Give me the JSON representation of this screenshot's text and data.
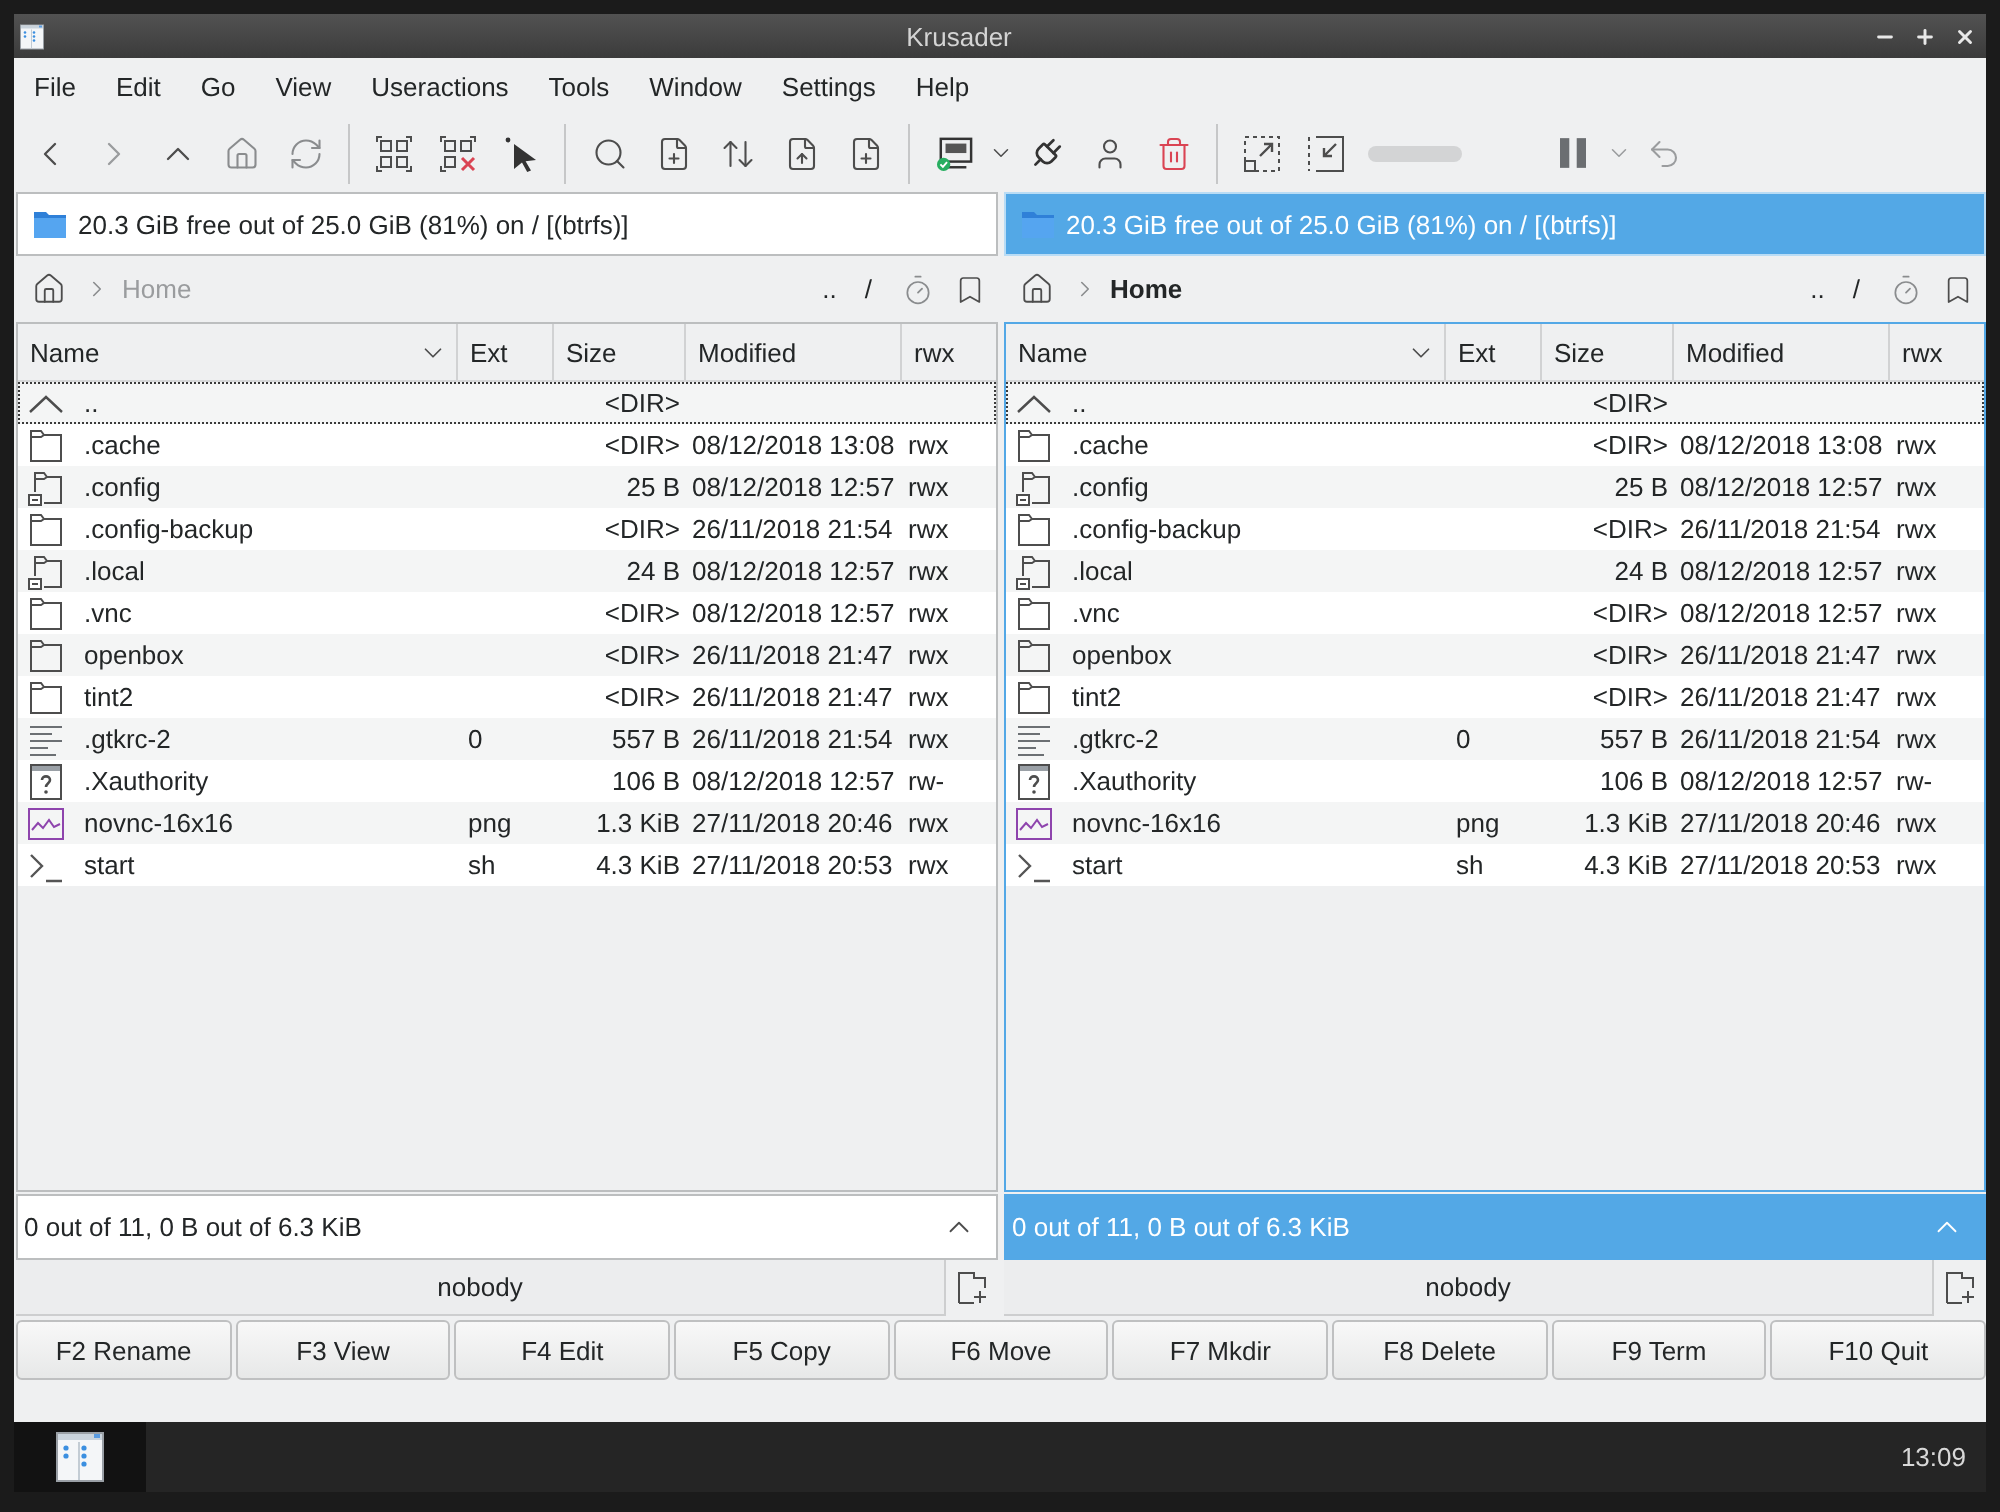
{
  "window": {
    "title": "Krusader"
  },
  "menu": [
    "File",
    "Edit",
    "Go",
    "View",
    "Useractions",
    "Tools",
    "Window",
    "Settings",
    "Help"
  ],
  "toolbar": {
    "progress": {
      "level": 0
    }
  },
  "panels": [
    {
      "active": false,
      "disk_info": "20.3 GiB free out of 25.0 GiB (81%) on / [(btrfs)]",
      "breadcrumb": "Home",
      "path_buttons": [
        "..",
        "/"
      ],
      "columns": [
        {
          "label": "Name",
          "sorted": true
        },
        {
          "label": "Ext",
          "sorted": false
        },
        {
          "label": "Size",
          "sorted": false
        },
        {
          "label": "Modified",
          "sorted": false
        },
        {
          "label": "rwx",
          "sorted": false
        }
      ],
      "rows": [
        {
          "kind": "parent",
          "name": "..",
          "size": "<DIR>",
          "focused": true
        },
        {
          "kind": "folder",
          "name": ".cache",
          "size": "<DIR>",
          "modified": "08/12/2018 13:08",
          "rwx": "rwx",
          "focused": false
        },
        {
          "kind": "symlink",
          "name": ".config",
          "size": "25 B",
          "modified": "08/12/2018 12:57",
          "rwx": "rwx",
          "focused": false
        },
        {
          "kind": "folder",
          "name": ".config-backup",
          "size": "<DIR>",
          "modified": "26/11/2018 21:54",
          "rwx": "rwx",
          "focused": false
        },
        {
          "kind": "symlink",
          "name": ".local",
          "size": "24 B",
          "modified": "08/12/2018 12:57",
          "rwx": "rwx",
          "focused": false
        },
        {
          "kind": "folder",
          "name": ".vnc",
          "size": "<DIR>",
          "modified": "08/12/2018 12:57",
          "rwx": "rwx",
          "focused": false
        },
        {
          "kind": "folder",
          "name": "openbox",
          "size": "<DIR>",
          "modified": "26/11/2018 21:47",
          "rwx": "rwx",
          "focused": false
        },
        {
          "kind": "folder",
          "name": "tint2",
          "size": "<DIR>",
          "modified": "26/11/2018 21:47",
          "rwx": "rwx",
          "focused": false
        },
        {
          "kind": "text",
          "name": ".gtkrc-2",
          "ext": "0",
          "size": "557 B",
          "modified": "26/11/2018 21:54",
          "rwx": "rwx",
          "focused": false
        },
        {
          "kind": "unknown",
          "name": ".Xauthority",
          "size": "106 B",
          "modified": "08/12/2018 12:57",
          "rwx": "rw-",
          "focused": false
        },
        {
          "kind": "image",
          "name": "novnc-16x16",
          "ext": "png",
          "size": "1.3 KiB",
          "modified": "27/11/2018 20:46",
          "rwx": "rwx",
          "focused": false
        },
        {
          "kind": "script",
          "name": "start",
          "ext": "sh",
          "size": "4.3 KiB",
          "modified": "27/11/2018 20:53",
          "rwx": "rwx",
          "focused": false
        }
      ],
      "status": "0 out of 11, 0 B out of 6.3 KiB",
      "user": "nobody"
    },
    {
      "active": true,
      "disk_info": "20.3 GiB free out of 25.0 GiB (81%) on / [(btrfs)]",
      "breadcrumb": "Home",
      "path_buttons": [
        "..",
        "/"
      ],
      "columns": [
        {
          "label": "Name",
          "sorted": true
        },
        {
          "label": "Ext",
          "sorted": false
        },
        {
          "label": "Size",
          "sorted": false
        },
        {
          "label": "Modified",
          "sorted": false
        },
        {
          "label": "rwx",
          "sorted": false
        }
      ],
      "rows": [
        {
          "kind": "parent",
          "name": "..",
          "size": "<DIR>",
          "focused": true
        },
        {
          "kind": "folder",
          "name": ".cache",
          "size": "<DIR>",
          "modified": "08/12/2018 13:08",
          "rwx": "rwx",
          "focused": false
        },
        {
          "kind": "symlink",
          "name": ".config",
          "size": "25 B",
          "modified": "08/12/2018 12:57",
          "rwx": "rwx",
          "focused": false
        },
        {
          "kind": "folder",
          "name": ".config-backup",
          "size": "<DIR>",
          "modified": "26/11/2018 21:54",
          "rwx": "rwx",
          "focused": false
        },
        {
          "kind": "symlink",
          "name": ".local",
          "size": "24 B",
          "modified": "08/12/2018 12:57",
          "rwx": "rwx",
          "focused": false
        },
        {
          "kind": "folder",
          "name": ".vnc",
          "size": "<DIR>",
          "modified": "08/12/2018 12:57",
          "rwx": "rwx",
          "focused": false
        },
        {
          "kind": "folder",
          "name": "openbox",
          "size": "<DIR>",
          "modified": "26/11/2018 21:47",
          "rwx": "rwx",
          "focused": false
        },
        {
          "kind": "folder",
          "name": "tint2",
          "size": "<DIR>",
          "modified": "26/11/2018 21:47",
          "rwx": "rwx",
          "focused": false
        },
        {
          "kind": "text",
          "name": ".gtkrc-2",
          "ext": "0",
          "size": "557 B",
          "modified": "26/11/2018 21:54",
          "rwx": "rwx",
          "focused": false
        },
        {
          "kind": "unknown",
          "name": ".Xauthority",
          "size": "106 B",
          "modified": "08/12/2018 12:57",
          "rwx": "rw-",
          "focused": false
        },
        {
          "kind": "image",
          "name": "novnc-16x16",
          "ext": "png",
          "size": "1.3 KiB",
          "modified": "27/11/2018 20:46",
          "rwx": "rwx",
          "focused": false
        },
        {
          "kind": "script",
          "name": "start",
          "ext": "sh",
          "size": "4.3 KiB",
          "modified": "27/11/2018 20:53",
          "rwx": "rwx",
          "focused": false
        }
      ],
      "status": "0 out of 11, 0 B out of 6.3 KiB",
      "user": "nobody"
    }
  ],
  "function_keys": [
    "F2 Rename",
    "F3 View",
    "F4 Edit",
    "F5 Copy",
    "F6 Move",
    "F7 Mkdir",
    "F8 Delete",
    "F9 Term",
    "F10 Quit"
  ],
  "taskbar": {
    "clock": "13:09"
  }
}
